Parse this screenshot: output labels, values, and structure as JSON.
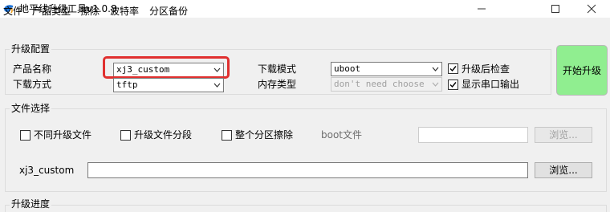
{
  "window": {
    "title": "地平线升级工具v1.0.8",
    "icon": "bird-logo-icon"
  },
  "menu": [
    "文件",
    "产品类型",
    "擦除",
    "波特率",
    "分区备份"
  ],
  "upgrade_config": {
    "group_label": "升级配置",
    "product_name_label": "产品名称",
    "product_name_value": "xj3_custom",
    "download_method_label": "下载方式",
    "download_method_value": "tftp",
    "download_mode_label": "下载模式",
    "download_mode_value": "uboot",
    "memory_type_label": "内存类型",
    "memory_type_value": "don't need choose",
    "check_after_upgrade_label": "升级后检查",
    "check_after_upgrade_checked": true,
    "show_serial_output_label": "显示串口输出",
    "show_serial_output_checked": true,
    "start_button": "开始升级",
    "start_button_color": "#90ee90",
    "highlight_color": "#e0302f"
  },
  "file_select": {
    "group_label": "文件选择",
    "diff_upgrade_label": "不同升级文件",
    "diff_upgrade_checked": false,
    "segment_label": "升级文件分段",
    "segment_checked": false,
    "erase_all_label": "整个分区擦除",
    "erase_all_checked": false,
    "boot_file_label": "boot文件",
    "boot_file_value": "",
    "boot_browse_button": "浏览...",
    "image_label": "xj3_custom",
    "image_value": "",
    "image_browse_button": "浏览..."
  },
  "progress": {
    "group_label": "升级进度"
  }
}
